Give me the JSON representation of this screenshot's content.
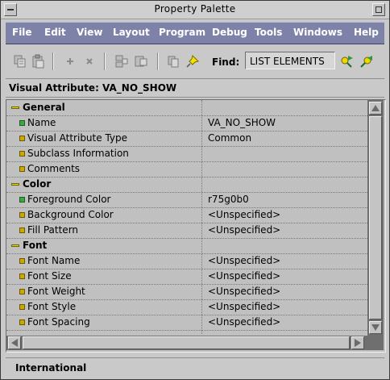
{
  "window": {
    "title": "Property Palette"
  },
  "menu": {
    "items": [
      {
        "label": "File"
      },
      {
        "label": "Edit"
      },
      {
        "label": "View"
      },
      {
        "label": "Layout"
      },
      {
        "label": "Program"
      },
      {
        "label": "Debug"
      },
      {
        "label": "Tools"
      },
      {
        "label": "Windows"
      },
      {
        "label": "Help"
      }
    ]
  },
  "toolbar": {
    "icons": [
      "copy-properties-icon",
      "paste-properties-icon",
      "add-property-icon",
      "delete-property-icon",
      "intersection-icon",
      "union-icon",
      "inherit-icon",
      "freeze-icon",
      "find-next-icon",
      "find-prev-icon"
    ],
    "find_label": "Find:",
    "find_value": "LIST ELEMENTS"
  },
  "context": {
    "text": "Visual Attribute: VA_NO_SHOW"
  },
  "properties": [
    {
      "type": "group",
      "name": "General",
      "value": ""
    },
    {
      "type": "prop",
      "name": "Name",
      "value": "VA_NO_SHOW",
      "bullet": "green"
    },
    {
      "type": "prop",
      "name": "Visual Attribute Type",
      "value": "Common",
      "bullet": "yellow"
    },
    {
      "type": "prop",
      "name": "Subclass Information",
      "value": "",
      "bullet": "yellow"
    },
    {
      "type": "prop",
      "name": "Comments",
      "value": "",
      "bullet": "yellow"
    },
    {
      "type": "group",
      "name": "Color",
      "value": ""
    },
    {
      "type": "prop",
      "name": "Foreground Color",
      "value": "r75g0b0",
      "bullet": "green"
    },
    {
      "type": "prop",
      "name": "Background Color",
      "value": "<Unspecified>",
      "bullet": "yellow"
    },
    {
      "type": "prop",
      "name": "Fill Pattern",
      "value": "<Unspecified>",
      "bullet": "yellow"
    },
    {
      "type": "group",
      "name": "Font",
      "value": ""
    },
    {
      "type": "prop",
      "name": "Font Name",
      "value": "<Unspecified>",
      "bullet": "yellow"
    },
    {
      "type": "prop",
      "name": "Font Size",
      "value": "<Unspecified>",
      "bullet": "yellow"
    },
    {
      "type": "prop",
      "name": "Font Weight",
      "value": "<Unspecified>",
      "bullet": "yellow"
    },
    {
      "type": "prop",
      "name": "Font Style",
      "value": "<Unspecified>",
      "bullet": "yellow"
    },
    {
      "type": "prop",
      "name": "Font Spacing",
      "value": "<Unspecified>",
      "bullet": "yellow"
    }
  ],
  "status": {
    "text": "International"
  },
  "colors": {
    "menubar": "#7f82a8",
    "grid": "#c0c0c0",
    "scroll_track": "#6f6f6f"
  }
}
